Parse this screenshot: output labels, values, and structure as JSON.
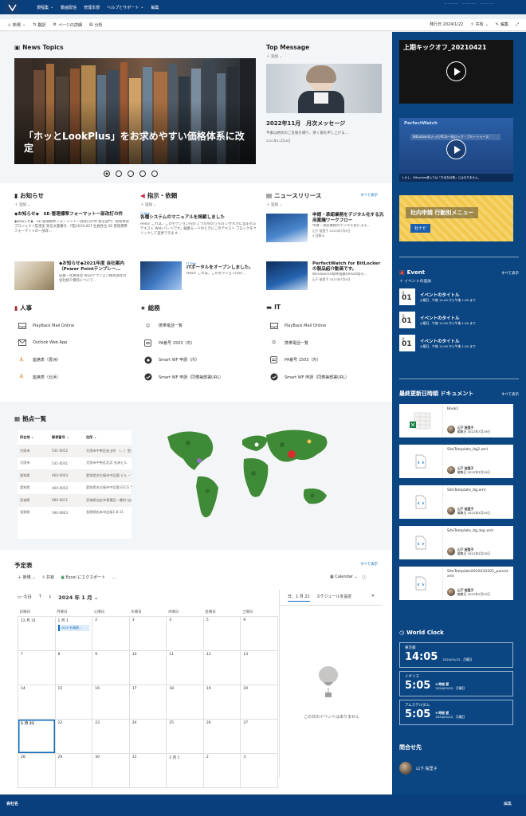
{
  "topnav": {
    "items": [
      "規程集",
      "動画配信",
      "管理本部",
      "ヘルプとサポート",
      "編集"
    ],
    "right_blurb": "…………　…………　…………"
  },
  "commandbar": {
    "new": "新規",
    "translate": "翻訳",
    "page_details": "ページの詳細",
    "analytics": "分析",
    "published": "発行日 2024/1/22",
    "share": "共有",
    "edit": "編集"
  },
  "news": {
    "title": "News Topics",
    "hero_title": "「ホッとLookPlus」をお求めやすい価格体系に改定",
    "pages": 5,
    "active_page": 1
  },
  "top_message": {
    "title": "Top Message",
    "add": "追加",
    "headline": "2022年11月　月次メッセージ",
    "summary": "平素は格別のご支援を賜り、厚く御礼申し上げま…",
    "date": "2021年11月26日"
  },
  "notices": {
    "title": "お知らせ",
    "add": "追加",
    "items": [
      {
        "title": "◆お知らせ◆　SE-管理標準フォーマット一部改訂の件",
        "desc": "◆お知らせ◆　SE-管理標準フォーマット一部改訂の件 発信部門：管理本部　プロジェクト監理室 発信文書番号：P監2019-007 社員各位 SE-管理標準フォーマットの一部改…"
      },
      {
        "title": "◆お知らせ◆2021年度 会社案内（Power Pointテンプレー…",
        "desc": "役員・社員各位 Wiseテクノロジ株式会社の会社紹介資料について…"
      }
    ]
  },
  "instructions": {
    "title": "指示・依頼",
    "add": "追加",
    "items": [
      {
        "tag": "IT Site",
        "title": "各種システムのマニュアルを掲載しました",
        "desc": "Hello! これは、このセクション内の 2 つの列のうちの いずれかに含まれるテキスト Web パーツです。編集モードのときにこのテキスト ブロックをクリックして変更できます…"
      },
      {
        "tag": "IT Site",
        "title": "ITポータルをオープンしました。",
        "desc": "Hello! これは、このセクション内の…"
      }
    ]
  },
  "releases": {
    "title": "ニュースリリース",
    "see_all": "すべて表示",
    "add": "追加",
    "items": [
      {
        "title": "申請・承認業務をデジタル化する汎用稟議ワークフロー",
        "desc": "申請・承認業務のデジタル化による…",
        "author": "山下 桜里子 2021年7月5日",
        "views": "4 回表示"
      },
      {
        "title": "PerfectWatch for BitLockerの製品紹介動画です。",
        "desc": "Windows10標準搭載のHDD暗号…",
        "author": "山下 桜里子 2021年7月5日",
        "views": ""
      }
    ]
  },
  "links": {
    "hr": {
      "title": "人事",
      "items": [
        "PlayBack Mail Online",
        "Outlook Web App",
        "座席表（豊洲）",
        "座席表（北浜）"
      ]
    },
    "ga": {
      "title": "総務",
      "items": [
        "携帯電話一覧",
        "PA番号 1503（内）",
        "Smart WF 申請（内）",
        "Smart WF 申請（同僚兼部署URL）"
      ]
    },
    "it": {
      "title": "IT",
      "items": [
        "PlayBack Mail Online",
        "携帯電話一覧",
        "PA番号 1503（内）",
        "Smart WF 申請（同僚兼部署URL）"
      ]
    }
  },
  "bases": {
    "title": "拠点一覧",
    "columns": [
      "所在地",
      "郵便番号",
      "住所"
    ],
    "rows": [
      [
        "大阪市",
        "541-0052",
        "大阪市中央区安土町 （…）堂ビル5F"
      ],
      [
        "大阪市",
        "541-0041",
        "大阪市中央区北浜 名洲ビル"
      ],
      [
        "愛知県",
        "460-0003",
        "愛知県名古屋市中区錦 ビル・アネックスF"
      ],
      [
        "愛知県",
        "460-0003",
        "愛知県名古屋市中区錦 ELCG 5F"
      ],
      [
        "宮城県",
        "980-0811",
        "宮城県仙台市青葉区一番町 仙台電気ビルF"
      ],
      [
        "長野県",
        "390-0863",
        "長野県松本市白板1-8-31"
      ]
    ]
  },
  "calendar": {
    "title": "予定表",
    "see_all": "すべて表示",
    "new": "新規",
    "share": "共有",
    "export": "Excel にエクスポート",
    "view": "Calendar",
    "today": "今日",
    "month": "2024 年 1 月",
    "weekdays": [
      "日曜日",
      "月曜日",
      "火曜日",
      "水曜日",
      "木曜日",
      "金曜日",
      "土曜日"
    ],
    "weeks": [
      [
        "12 月 31",
        "1 月 1",
        "2",
        "3",
        "4",
        "5",
        "6"
      ],
      [
        "7",
        "8",
        "9",
        "10",
        "11",
        "12",
        "13"
      ],
      [
        "14",
        "15",
        "16",
        "17",
        "18",
        "19",
        "20"
      ],
      [
        "1 月 21",
        "22",
        "23",
        "24",
        "25",
        "26",
        "27"
      ],
      [
        "28",
        "29",
        "30",
        "31",
        "2 月 1",
        "2",
        "3"
      ]
    ],
    "event_label": "2020 社員旅…",
    "side_date": "日、1 月 21",
    "side_tab": "スケジュールを設定",
    "empty": "この日のイベントはありません"
  },
  "right": {
    "video1_title": "上期キックオフ_20210421",
    "video2_title": "PerfectWatch",
    "video2_sub": "BitLockerの入ったPCの一括ロック・ブルートゥース　　　",
    "video2_caption": "しかし、BitLocker導入では「万全な対策」にはなりません。",
    "app_title": "社内申請 行動別メニュー",
    "app_btn": "社ナビ",
    "event": {
      "title": "Event",
      "see_all": "すべて表示",
      "add": "イベントの追加",
      "items": [
        {
          "month": "月",
          "day": "01",
          "title": "イベントのタイトル",
          "time": "火曜日、午後 12:00 から午後 1:00 まで"
        },
        {
          "month": "月",
          "day": "01",
          "title": "イベントのタイトル",
          "time": "火曜日、午後 12:00 から午後 1:00 まで"
        },
        {
          "month": "月",
          "day": "01",
          "title": "イベントのタイトル",
          "time": "火曜日、午後 12:00 から午後 1:00 まで"
        }
      ]
    },
    "docs": {
      "title": "最終更新日時順 ドキュメント",
      "see_all": "すべて表示",
      "items": [
        {
          "name": "Book1",
          "author": "山下 桜里子",
          "date": "編集日 2022年7月19日"
        },
        {
          "name": "SiteTemplate_itg2.xml",
          "author": "山下 桜里子",
          "date": "編集日 2022年3月25日"
        },
        {
          "name": "SiteTemplate_itg.xml",
          "author": "山下 桜里子",
          "date": "編集日 2022年3月25日"
        },
        {
          "name": "SiteTemplate_itg_top.xml",
          "author": "山下 桜里子",
          "date": "編集日 2022年3月25日"
        },
        {
          "name": "SiteTemplate2022032201_parent.xml",
          "author": "山下 桜里子",
          "date": "編集日 2022年3月25日"
        }
      ]
    },
    "clock": {
      "title": "World Clock",
      "items": [
        {
          "city": "東京都",
          "time": "14:05",
          "sub": "",
          "date": "2024/01/22、月曜日"
        },
        {
          "city": "イギリス",
          "time": "5:05",
          "sub": "9 時間 遅",
          "date": "2024/01/22、月曜日"
        },
        {
          "city": "アムステルダム",
          "time": "5:05",
          "sub": "9 時間 遅",
          "date": "2024/01/22、月曜日"
        }
      ]
    },
    "contact": {
      "title": "問合せ先",
      "name": "山下 桜里子"
    }
  },
  "footer": {
    "company": "会社名",
    "edit": "編集"
  },
  "colors": {
    "brand": "#0a3f7d",
    "side": "#0b4683",
    "accent": "#0f6cbd"
  }
}
